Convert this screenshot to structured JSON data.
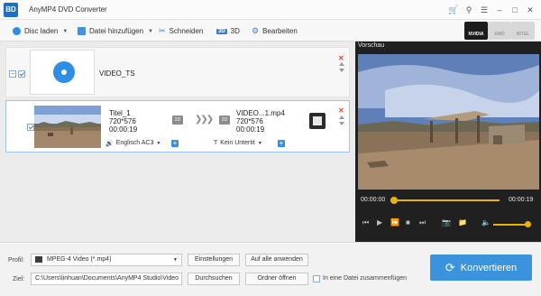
{
  "window": {
    "title": "AnyMP4 DVD Converter",
    "logo_text": "BD",
    "controls": [
      "cart-icon",
      "key-icon",
      "menu-icon",
      "minimize-icon",
      "maximize-icon",
      "close-icon"
    ]
  },
  "toolbar": {
    "load_disc": "Disc laden",
    "add_file": "Datei hinzufügen",
    "cut": "Schneiden",
    "threed": "3D",
    "edit": "Bearbeiten",
    "threed_icon_text": "3D"
  },
  "gpu": {
    "nvidia": "NVIDIA",
    "amd": "AMD",
    "intel": "INTEL"
  },
  "group": {
    "name": "VIDEO_TS"
  },
  "file": {
    "source_title": "Titel_1",
    "source_resolution": "720*576",
    "source_duration": "00:00:19",
    "badge_source": "2D",
    "output_name": "VIDEO...1.mp4",
    "output_resolution": "720*576",
    "output_duration": "00:00:19",
    "badge_output": "2D",
    "audio_track": "Englisch AC3",
    "subtitle": "Kein Untertit"
  },
  "preview": {
    "label": "Vorschau",
    "time_current": "00:00:00",
    "time_total": "00:00:19",
    "progress": 1.0,
    "volume": 0.9
  },
  "bottom": {
    "profile_label": "Profil:",
    "profile_value": "MPEG-4 Video (*.mp4)",
    "settings_button": "Einstellungen",
    "apply_all_button": "Auf alle anwenden",
    "target_label": "Ziel:",
    "target_path": "C:\\Users\\linhuan\\Documents\\AnyMP4 Studio\\Video",
    "browse_button": "Durchsuchen",
    "open_folder_button": "Ordner öffnen",
    "merge_label": "In eine Datei zusammenfügen",
    "convert_button": "Konvertieren"
  },
  "colors": {
    "accent": "#3a93db",
    "seek": "#e8b400",
    "preview_bg": "#202020"
  }
}
